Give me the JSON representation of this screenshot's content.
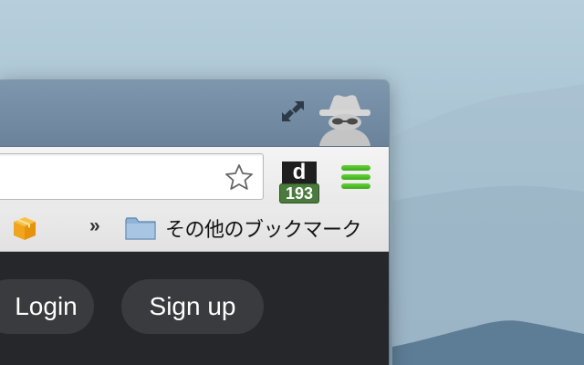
{
  "titlebar": {
    "fullscreen_icon": "fullscreen-arrows-icon",
    "profile_icon": "incognito-icon"
  },
  "toolbar": {
    "omnibox_value": "",
    "star_icon": "bookmark-star-icon",
    "extension": {
      "letter": "d",
      "badge": "193",
      "badge_color": "#4a7a3d"
    },
    "menu_icon": "hamburger-menu-icon",
    "menu_color": "#4cbb22"
  },
  "bookmarks": {
    "first_item_icon": "package-box-icon",
    "overflow_label": "»",
    "other_label": "その他のブックマーク",
    "other_icon": "folder-icon"
  },
  "page": {
    "login_label": "Login",
    "signup_label": "Sign up"
  }
}
